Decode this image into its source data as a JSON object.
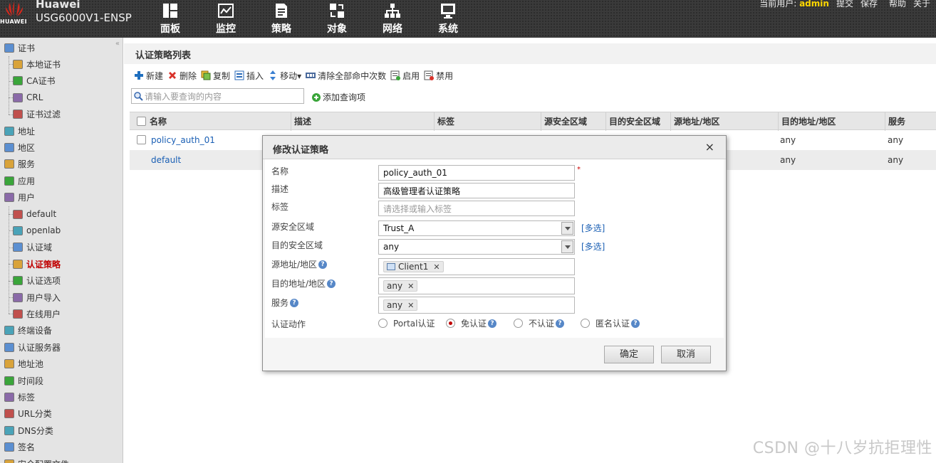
{
  "brand": {
    "logo_text": "HUAWEI",
    "name": "Huawei",
    "model": "USG6000V1-ENSP"
  },
  "topnav": [
    {
      "label": "面板",
      "icon": "dashboard-icon"
    },
    {
      "label": "监控",
      "icon": "monitor-icon"
    },
    {
      "label": "策略",
      "icon": "policy-icon"
    },
    {
      "label": "对象",
      "icon": "object-icon"
    },
    {
      "label": "网络",
      "icon": "network-icon"
    },
    {
      "label": "系统",
      "icon": "system-icon"
    }
  ],
  "userbar": {
    "prefix": "当前用户:",
    "user": "admin",
    "commit": "提交",
    "save": "保存",
    "help": "帮助",
    "about": "关于"
  },
  "sidebar": {
    "items": [
      {
        "label": "证书",
        "level": 0
      },
      {
        "label": "本地证书",
        "level": 1
      },
      {
        "label": "CA证书",
        "level": 1
      },
      {
        "label": "CRL",
        "level": 1
      },
      {
        "label": "证书过滤",
        "level": 1
      },
      {
        "label": "地址",
        "level": 0
      },
      {
        "label": "地区",
        "level": 0
      },
      {
        "label": "服务",
        "level": 0
      },
      {
        "label": "应用",
        "level": 0
      },
      {
        "label": "用户",
        "level": 0
      },
      {
        "label": "default",
        "level": 1
      },
      {
        "label": "openlab",
        "level": 1
      },
      {
        "label": "认证域",
        "level": 1
      },
      {
        "label": "认证策略",
        "level": 1,
        "active": true
      },
      {
        "label": "认证选项",
        "level": 1
      },
      {
        "label": "用户导入",
        "level": 1
      },
      {
        "label": "在线用户",
        "level": 1
      },
      {
        "label": "终端设备",
        "level": 0
      },
      {
        "label": "认证服务器",
        "level": 0
      },
      {
        "label": "地址池",
        "level": 0
      },
      {
        "label": "时间段",
        "level": 0
      },
      {
        "label": "标签",
        "level": 0
      },
      {
        "label": "URL分类",
        "level": 0
      },
      {
        "label": "DNS分类",
        "level": 0
      },
      {
        "label": "签名",
        "level": 0
      },
      {
        "label": "安全配置文件",
        "level": 0
      }
    ]
  },
  "page": {
    "title": "认证策略列表"
  },
  "toolbar": {
    "new": "新建",
    "delete": "删除",
    "copy": "复制",
    "insert": "插入",
    "move": "移动▾",
    "clear_hits": "清除全部命中次数",
    "enable": "启用",
    "disable": "禁用"
  },
  "search": {
    "placeholder": "请输入要查询的内容",
    "add_query": "添加查询项"
  },
  "grid": {
    "columns": [
      "名称",
      "描述",
      "标签",
      "源安全区域",
      "目的安全区域",
      "源地址/地区",
      "目的地址/地区",
      "服务"
    ],
    "rows": [
      {
        "name": "policy_auth_01",
        "dst_addr": "any",
        "service": "any"
      },
      {
        "name": "default",
        "dst_addr": "any",
        "service": "any"
      }
    ]
  },
  "dialog": {
    "title": "修改认证策略",
    "close": "×",
    "fields": {
      "name_label": "名称",
      "name_value": "policy_auth_01",
      "desc_label": "描述",
      "desc_value": "高级管理者认证策略",
      "tag_label": "标签",
      "tag_placeholder": "请选择或输入标签",
      "src_zone_label": "源安全区域",
      "src_zone_value": "Trust_A",
      "dst_zone_label": "目的安全区域",
      "dst_zone_value": "any",
      "multi_select": "[多选]",
      "src_addr_label": "源地址/地区",
      "src_addr_tag": "Client1",
      "dst_addr_label": "目的地址/地区",
      "dst_addr_tag": "any",
      "service_label": "服务",
      "service_tag": "any",
      "action_label": "认证动作",
      "action_options": [
        "Portal认证",
        "免认证",
        "不认证",
        "匿名认证"
      ],
      "action_selected": "免认证"
    },
    "ok": "确定",
    "cancel": "取消"
  },
  "watermark": "CSDN @十八岁抗拒理性",
  "colors": {
    "accent_red": "#c00000",
    "link_blue": "#1a5fb4",
    "user_yellow": "#ffd700"
  }
}
